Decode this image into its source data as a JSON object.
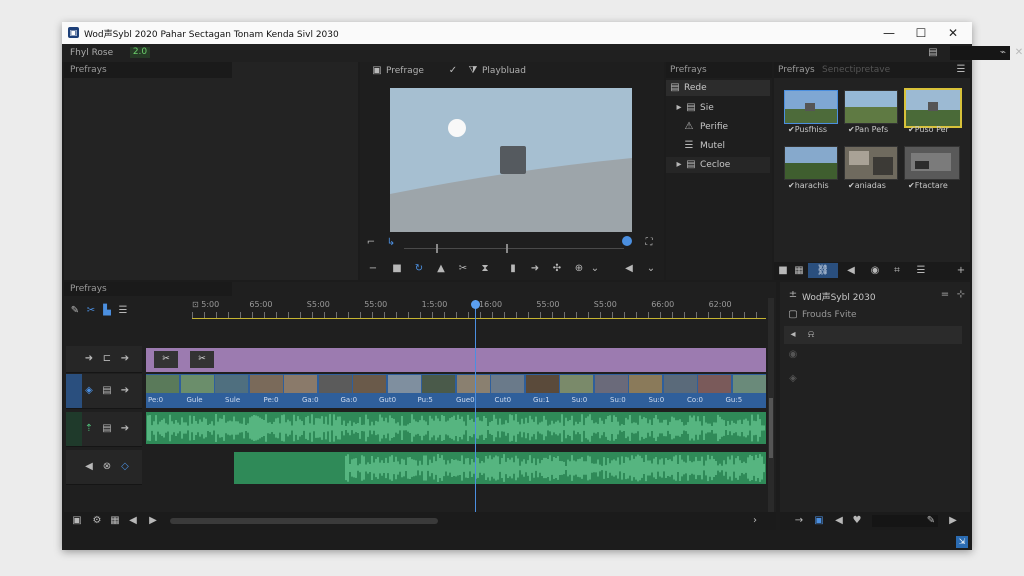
{
  "window": {
    "title": "Wod声Sybl 2020  Pahar  Sectagan  Tonam  Kenda Sivl 2030",
    "app_icon": "app-icon",
    "controls": {
      "minimize": "—",
      "maximize": "☐",
      "close": "✕"
    }
  },
  "menubar": {
    "project_label": "Fhyl Rose",
    "version": "2.0"
  },
  "left_panel": {
    "title": "Prefrays"
  },
  "preview": {
    "tab1": "Prefrage",
    "tab2": "Playbluad",
    "sky_color": "#a6bfd1",
    "ground_color": "#9aa3a8"
  },
  "media_tree": {
    "title": "Prefrays",
    "items": [
      {
        "label": "Rede",
        "icon": "list-icon"
      },
      {
        "label": "Sie",
        "icon": "folder-icon"
      },
      {
        "label": "Perifie",
        "icon": "triangle-icon"
      },
      {
        "label": "Mutel",
        "icon": "list-icon"
      },
      {
        "label": "Cecloe",
        "icon": "folder-icon"
      }
    ]
  },
  "media_bin": {
    "title": "Prefrays",
    "subtitle": "Senectipretave",
    "items": [
      {
        "label": "✔Pusfhiss"
      },
      {
        "label": "✔Pan Pefs"
      },
      {
        "label": "✔Puso Per"
      },
      {
        "label": "✔harachis"
      },
      {
        "label": "✔aniadas"
      },
      {
        "label": "✔Ftactare"
      }
    ]
  },
  "timeline": {
    "title": "Prefrays",
    "ruler_labels": [
      "⊡ 5:00",
      "65:00",
      "S5:00",
      "55:00",
      "1:5:00",
      "16:00",
      "55:00",
      "S5:00",
      "66:00",
      "62:00"
    ],
    "clip_labels": [
      "✂",
      "✂"
    ],
    "video_clip_text": [
      "Pe:0",
      "Gule",
      "Sule",
      "Pe:0",
      "Ga:0",
      "Ga:0",
      "Gut0",
      "Pu:5",
      "Gue0",
      "Cut0",
      "Gu:1",
      "Su:0",
      "Su:0",
      "Su:0",
      "Co:0",
      "Gu:5"
    ],
    "playhead_percent": 53
  },
  "inspector": {
    "title": "Wod声Sybl 2030",
    "subtitle": "Frouds Fvite",
    "row_icon": "bell-icon"
  }
}
